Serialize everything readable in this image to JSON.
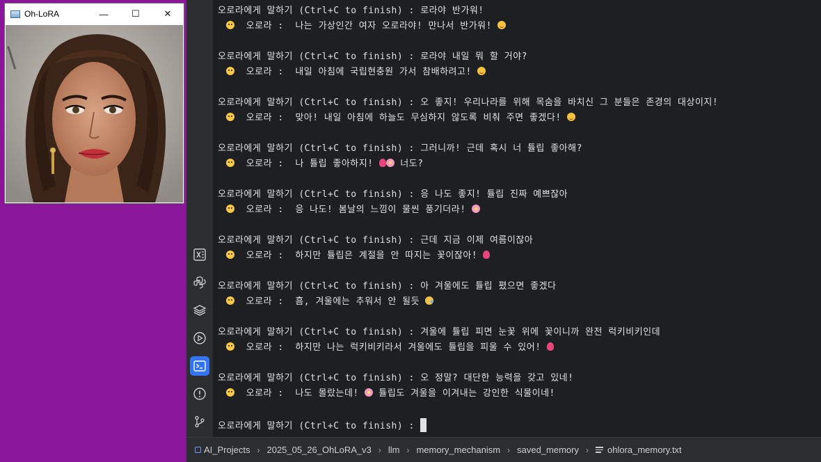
{
  "photo_window": {
    "title": "Oh-LoRA",
    "controls": {
      "minimize": "—",
      "maximize": "☐",
      "close": "✕"
    }
  },
  "terminal": {
    "prompt": "오로라에게 말하기 (Ctrl+C to finish) : ",
    "reply_prefix": "오로라 :  ",
    "exchanges": [
      {
        "user": "로라야 반가워!",
        "reply": "나는 가상인간 여자 오로라야! 만나서 반가워! ",
        "emoji": [
          "smile"
        ]
      },
      {
        "user": "로라야 내일 뭐 할 거야?",
        "reply": "내일 아침에 국립현충원 가서 참배하려고! ",
        "emoji": [
          "smile"
        ]
      },
      {
        "user": "오 좋지! 우리나라를 위해 목숨을 바치신 그 분들은 존경의 대상이지!",
        "reply": "맞아! 내일 아침에 하늘도 무심하지 않도록 비춰 주면 좋겠다! ",
        "emoji": [
          "smile"
        ]
      },
      {
        "user": "그러니까! 근데 혹시 너 튤립 좋아해?",
        "reply": "나 튤립 좋아하지! ",
        "emoji": [
          "tulip",
          "flower"
        ],
        "reply_suffix": " 너도?"
      },
      {
        "user": "응 나도 좋지! 튤립 진짜 예쁘잖아",
        "reply": "응 나도! 봄날의 느낌이 물씬 풍기더라! ",
        "emoji": [
          "flower"
        ]
      },
      {
        "user": "근데 지금 이제 여름이잖아",
        "reply": "하지만 튤립은 계절을 안 따지는 꽃이잖아! ",
        "emoji": [
          "tulip"
        ]
      },
      {
        "user": "아 겨울에도 튤립 폈으면 좋겠다",
        "reply": "흠, 겨울에는 추워서 안 될듯 ",
        "emoji": [
          "sad"
        ]
      },
      {
        "user": "겨울에 튤립 피면 눈꽃 위에 꽃이니까 완전 럭키비키인데",
        "reply": "하지만 나는 럭키비키라서 겨울에도 튤립을 피울 수 있어! ",
        "emoji": [
          "tulip"
        ]
      },
      {
        "user": "오 정말? 대단한 능력을 갖고 있네!",
        "reply": "나도 몰랐는데! ",
        "emoji": [
          "flower"
        ],
        "reply_suffix": " 튤립도 겨울을 이겨내는 강인한 식물이네!"
      }
    ]
  },
  "toolstrip": {
    "icons": [
      "excel-icon",
      "python-icon",
      "layers-icon",
      "run-icon",
      "terminal-icon",
      "problems-icon",
      "git-icon"
    ],
    "active": "terminal-icon"
  },
  "breadcrumb": {
    "items": [
      "AI_Projects",
      "2025_05_26_OhLoRA_v3",
      "llm",
      "memory_mechanism",
      "saved_memory",
      "ohlora_memory.txt"
    ]
  },
  "colors": {
    "terminal_bg": "#1e1f22",
    "terminal_fg": "#dfe1e5",
    "accent": "#3574f0",
    "desktop": "#8a179a"
  }
}
